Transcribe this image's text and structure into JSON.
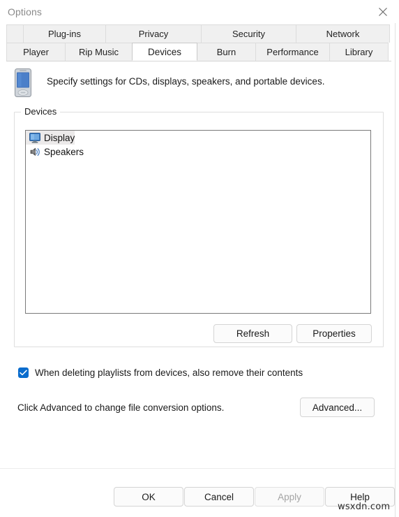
{
  "window": {
    "title": "Options",
    "close_icon": "close-icon"
  },
  "tabs": {
    "row_top": [
      {
        "label": "Plug-ins",
        "active": false
      },
      {
        "label": "Privacy",
        "active": false
      },
      {
        "label": "Security",
        "active": false
      },
      {
        "label": "Network",
        "active": false
      }
    ],
    "row_bottom": [
      {
        "label": "Player",
        "active": false
      },
      {
        "label": "Rip Music",
        "active": false
      },
      {
        "label": "Devices",
        "active": true
      },
      {
        "label": "Burn",
        "active": false
      },
      {
        "label": "Performance",
        "active": false
      },
      {
        "label": "Library",
        "active": false
      }
    ]
  },
  "header": {
    "icon": "pda-device-icon",
    "description": "Specify settings for CDs, displays, speakers, and portable devices."
  },
  "devices_group": {
    "legend": "Devices",
    "items": [
      {
        "label": "Display",
        "icon": "monitor-icon",
        "selected": true
      },
      {
        "label": "Speakers",
        "icon": "speaker-icon",
        "selected": false
      }
    ],
    "refresh_label": "Refresh",
    "properties_label": "Properties"
  },
  "options": {
    "delete_playlists_checkbox": {
      "label": "When deleting playlists from devices, also remove their contents",
      "checked": true
    },
    "advanced_text": "Click Advanced to change file conversion options.",
    "advanced_label": "Advanced..."
  },
  "footer": {
    "ok_label": "OK",
    "cancel_label": "Cancel",
    "apply_label": "Apply",
    "apply_disabled": true,
    "help_label": "Help"
  },
  "watermark": "wsxdn.com",
  "colors": {
    "accent": "#0a6ccd",
    "tab_inactive_bg": "#f0f0f0",
    "tab_active_bg": "#ffffff",
    "selection_bg": "#eceaea"
  }
}
